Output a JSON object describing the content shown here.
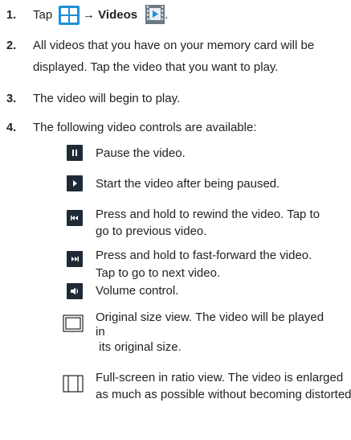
{
  "steps": [
    {
      "num": "1.",
      "pre": "Tap",
      "arrow": "→ Videos",
      "post": "."
    },
    {
      "num": "2.",
      "line1": "All videos that you have on your memory card will be",
      "line2": "displayed. Tap the video that you want to play."
    },
    {
      "num": "3.",
      "line1": "The video will begin to play."
    },
    {
      "num": "4.",
      "line1": "The following video controls are available:"
    }
  ],
  "controls": [
    {
      "icon": "pause-icon",
      "lines": [
        "Pause the video."
      ]
    },
    {
      "icon": "play-icon",
      "lines": [
        "Start the video after being paused."
      ]
    },
    {
      "icon": "rewind-icon",
      "lines": [
        "Press and hold to rewind the video. Tap to",
        "go to previous video."
      ]
    },
    {
      "icon": "fast-forward-icon",
      "lines": [
        "Press and hold to fast-forward the video.",
        "Tap to go to next video."
      ]
    },
    {
      "icon": "volume-icon",
      "lines": [
        "Volume control."
      ]
    },
    {
      "icon": "original-size-icon",
      "lines": [
        "Original size view. The video will be played",
        "in",
        " its original size."
      ]
    },
    {
      "icon": "full-screen-ratio-icon",
      "lines": [
        "Full-screen in ratio view. The video is enlarged",
        "as much as possible without becoming distorted."
      ]
    }
  ],
  "colors": {
    "menu_icon": "#1e8fd5",
    "control_icon": "#1f2a36",
    "text": "#222222"
  }
}
